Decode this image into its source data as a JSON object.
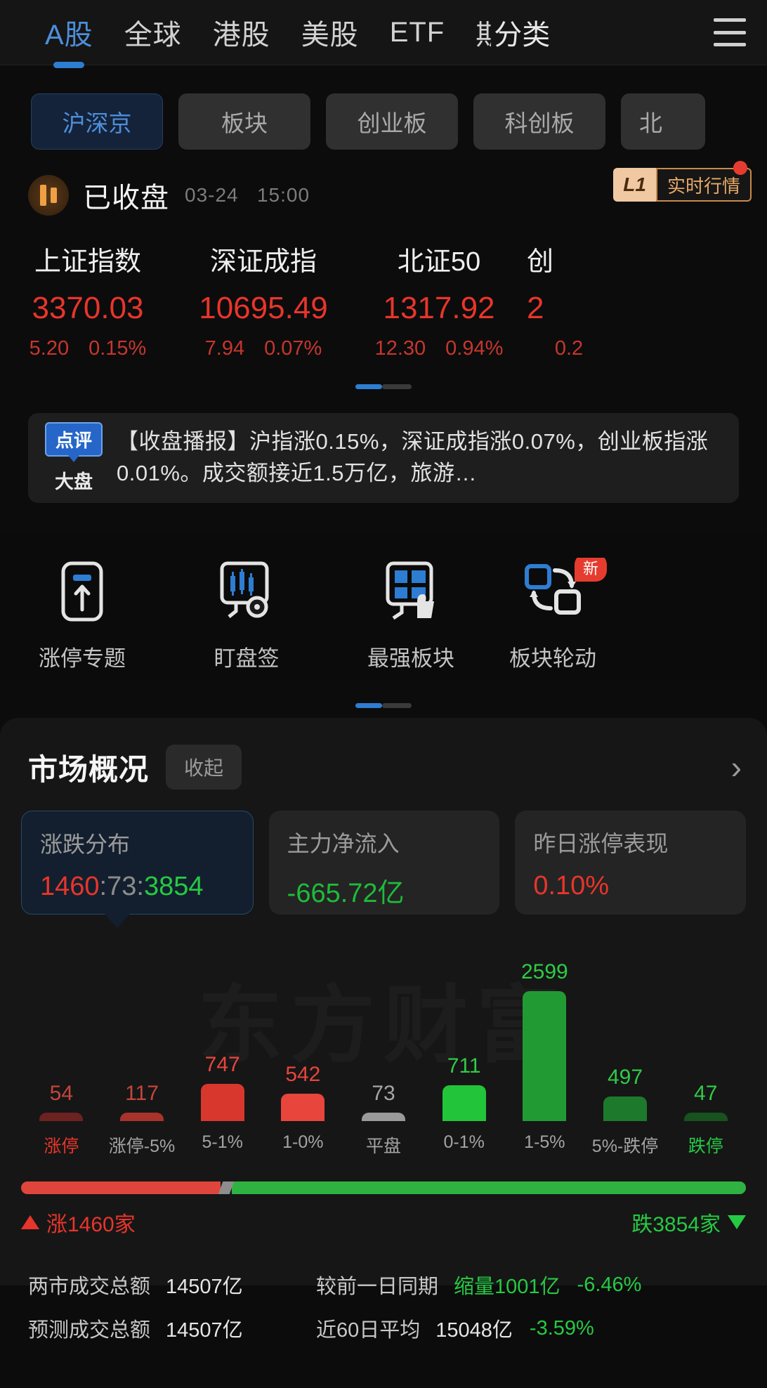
{
  "topnav": {
    "items": [
      {
        "label": "A股",
        "active": true
      },
      {
        "label": "全球",
        "active": false
      },
      {
        "label": "港股",
        "active": false
      },
      {
        "label": "美股",
        "active": false
      },
      {
        "label": "ETF",
        "active": false
      },
      {
        "label": "期",
        "active": false
      }
    ],
    "float_label": "分类",
    "menu_icon": "hamburger-menu-icon"
  },
  "chips": [
    {
      "label": "沪深京",
      "active": true
    },
    {
      "label": "板块",
      "active": false
    },
    {
      "label": "创业板",
      "active": false
    },
    {
      "label": "科创板",
      "active": false
    },
    {
      "label": "北",
      "active": false
    }
  ],
  "status": {
    "title": "已收盘",
    "date": "03-24",
    "time": "15:00",
    "level_badge": "L1",
    "quote_badge": "实时行情"
  },
  "indices": [
    {
      "name": "上证指数",
      "value": "3370.03",
      "change": "5.20",
      "percent": "0.15%"
    },
    {
      "name": "深证成指",
      "value": "10695.49",
      "change": "7.94",
      "percent": "0.07%"
    },
    {
      "name": "北证50",
      "value": "1317.92",
      "change": "12.30",
      "percent": "0.94%"
    },
    {
      "name": "创",
      "value": "2",
      "change": "",
      "percent": "0.2"
    }
  ],
  "news": {
    "badge_top": "点评",
    "badge_bottom": "大盘",
    "text": "【收盘播报】沪指涨0.15%，深证成指涨0.07%，创业板指涨0.01%。成交额接近1.5万亿，旅游…"
  },
  "shortcuts": [
    {
      "label": "涨停专题",
      "icon": "limit-up-topic-icon",
      "tag": ""
    },
    {
      "label": "盯盘签",
      "icon": "watch-market-tag-icon",
      "tag": ""
    },
    {
      "label": "最强板块",
      "icon": "strongest-sector-icon",
      "tag": ""
    },
    {
      "label": "板块轮动",
      "icon": "sector-rotation-icon",
      "tag": "新"
    }
  ],
  "section": {
    "title": "市场概况",
    "collapse_label": "收起",
    "chevron": "›"
  },
  "stat_tabs": [
    {
      "label": "涨跌分布",
      "active": true,
      "parts": [
        {
          "text": "1460",
          "tone": "red"
        },
        {
          "text": ":",
          "tone": "grey"
        },
        {
          "text": "73",
          "tone": "grey"
        },
        {
          "text": ":",
          "tone": "grey"
        },
        {
          "text": "3854",
          "tone": "green"
        }
      ]
    },
    {
      "label": "主力净流入",
      "active": false,
      "value": "-665.72亿",
      "tone": "green"
    },
    {
      "label": "昨日涨停表现",
      "active": false,
      "value": "0.10%",
      "tone": "red"
    }
  ],
  "watermark": "东方财富",
  "chart_data": {
    "type": "bar",
    "title": "涨跌分布",
    "categories": [
      "涨停",
      "涨停-5%",
      "5-1%",
      "1-0%",
      "平盘",
      "0-1%",
      "1-5%",
      "5%-跌停",
      "跌停"
    ],
    "values": [
      54,
      117,
      747,
      542,
      73,
      711,
      2599,
      497,
      47
    ],
    "colors": [
      "#6b2220",
      "#a8332c",
      "#d8372e",
      "#e8453c",
      "#9a9a9a",
      "#22c43a",
      "#229a34",
      "#1d7a2c",
      "#17521f"
    ],
    "label_colors": [
      "#c4453c",
      "#c4453c",
      "#e8453c",
      "#e8453c",
      "#a6a6a6",
      "#2ecb47",
      "#2ecb47",
      "#2ecb47",
      "#2ecb47"
    ],
    "tick_colors": [
      "#e8352b",
      "#a4a4a4",
      "#a4a4a4",
      "#a4a4a4",
      "#a4a4a4",
      "#a4a4a4",
      "#a4a4a4",
      "#a4a4a4",
      "#26c943"
    ],
    "ylabel": "",
    "xlabel": "",
    "ylim": [
      0,
      2599
    ],
    "grid": false
  },
  "ratio": {
    "up_pct": 27.5,
    "down_pct": 71.5,
    "up_label": "涨1460家",
    "down_label": "跌3854家"
  },
  "bottom_stats": [
    {
      "left_label": "两市成交总额",
      "left_value": "14507亿",
      "right_label": "较前一日同期",
      "right_value": "缩量1001亿",
      "right_value_tone": "green",
      "right_extra": "-6.46%",
      "right_extra_tone": "green"
    },
    {
      "left_label": "预测成交总额",
      "left_value": "14507亿",
      "right_label": "近60日平均",
      "right_value": "15048亿",
      "right_value_tone": "plain",
      "right_extra": "-3.59%",
      "right_extra_tone": "green"
    }
  ]
}
